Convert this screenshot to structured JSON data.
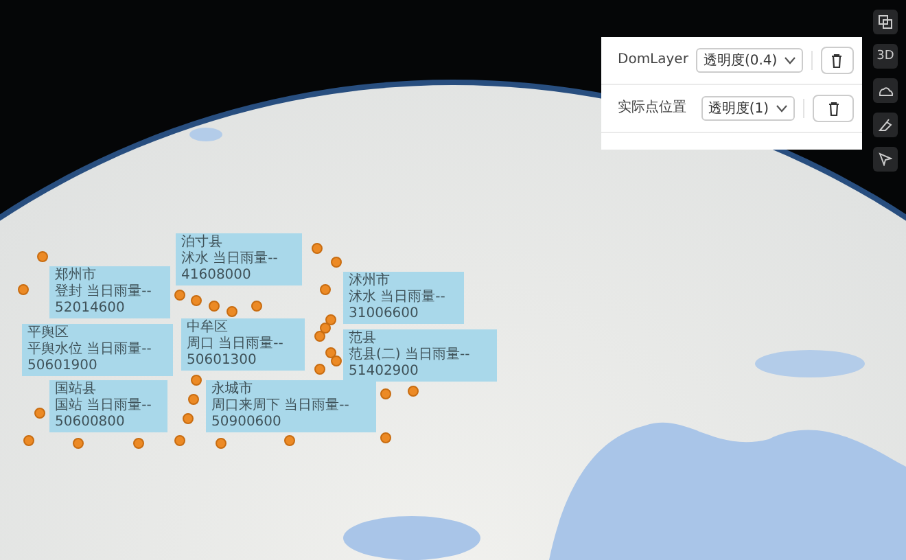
{
  "layer_panel": {
    "rows": [
      {
        "name": "DomLayer",
        "opacity_select": "透明度(0.4)"
      },
      {
        "name": "实际点位置",
        "opacity_select": "透明度(1)"
      }
    ]
  },
  "toolbar": [
    {
      "kind": "layers"
    },
    {
      "kind": "text",
      "label": "3D"
    },
    {
      "kind": "cloud"
    },
    {
      "kind": "eraser"
    },
    {
      "kind": "pointer"
    }
  ],
  "map_labels": [
    {
      "name": "泊寸县",
      "line": "沭水 当日雨量--",
      "code": "41608000"
    },
    {
      "name": "郑州市",
      "line": "登封 当日雨量--",
      "code": "52014600"
    },
    {
      "name": "沭州市",
      "line": "沭水 当日雨量--",
      "code": "31006600"
    },
    {
      "name": "平舆区",
      "line": "平舆水位 当日雨量--",
      "code": "50601900"
    },
    {
      "name": "中牟区",
      "line": "周口 当日雨量--",
      "code": "50601300"
    },
    {
      "name": "范县",
      "line": "范县(二) 当日雨量--",
      "code": "51402900"
    },
    {
      "name": "国站县",
      "line": "国站 当日雨量--",
      "code": "50600800"
    },
    {
      "name": "永城市",
      "line": "周口来周下 当日雨量--",
      "code": "50900600"
    }
  ]
}
